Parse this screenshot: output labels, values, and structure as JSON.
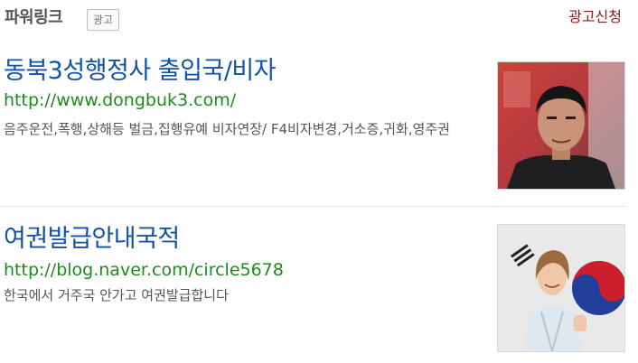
{
  "header": {
    "powerlink": "파워링크",
    "ad_badge": "광고",
    "apply": "광고신청"
  },
  "ads": [
    {
      "title": "동북3성행정사 출입국/비자",
      "url": "http://www.dongbuk3.com/",
      "description": "음주운전,폭행,상해등 벌금,집행유예 비자연장/ F4비자변경,거소증,귀화,영주권",
      "thumbnail": "person-photo"
    },
    {
      "title": "여권발급안내국적",
      "url": "http://blog.naver.com/circle5678",
      "description": "한국에서 거주국 안가고 여권발급합니다",
      "thumbnail": "woman-with-korean-flag"
    }
  ],
  "colors": {
    "title": "#1452a8",
    "url": "#1f8a1f",
    "apply": "#8b1a1a"
  }
}
